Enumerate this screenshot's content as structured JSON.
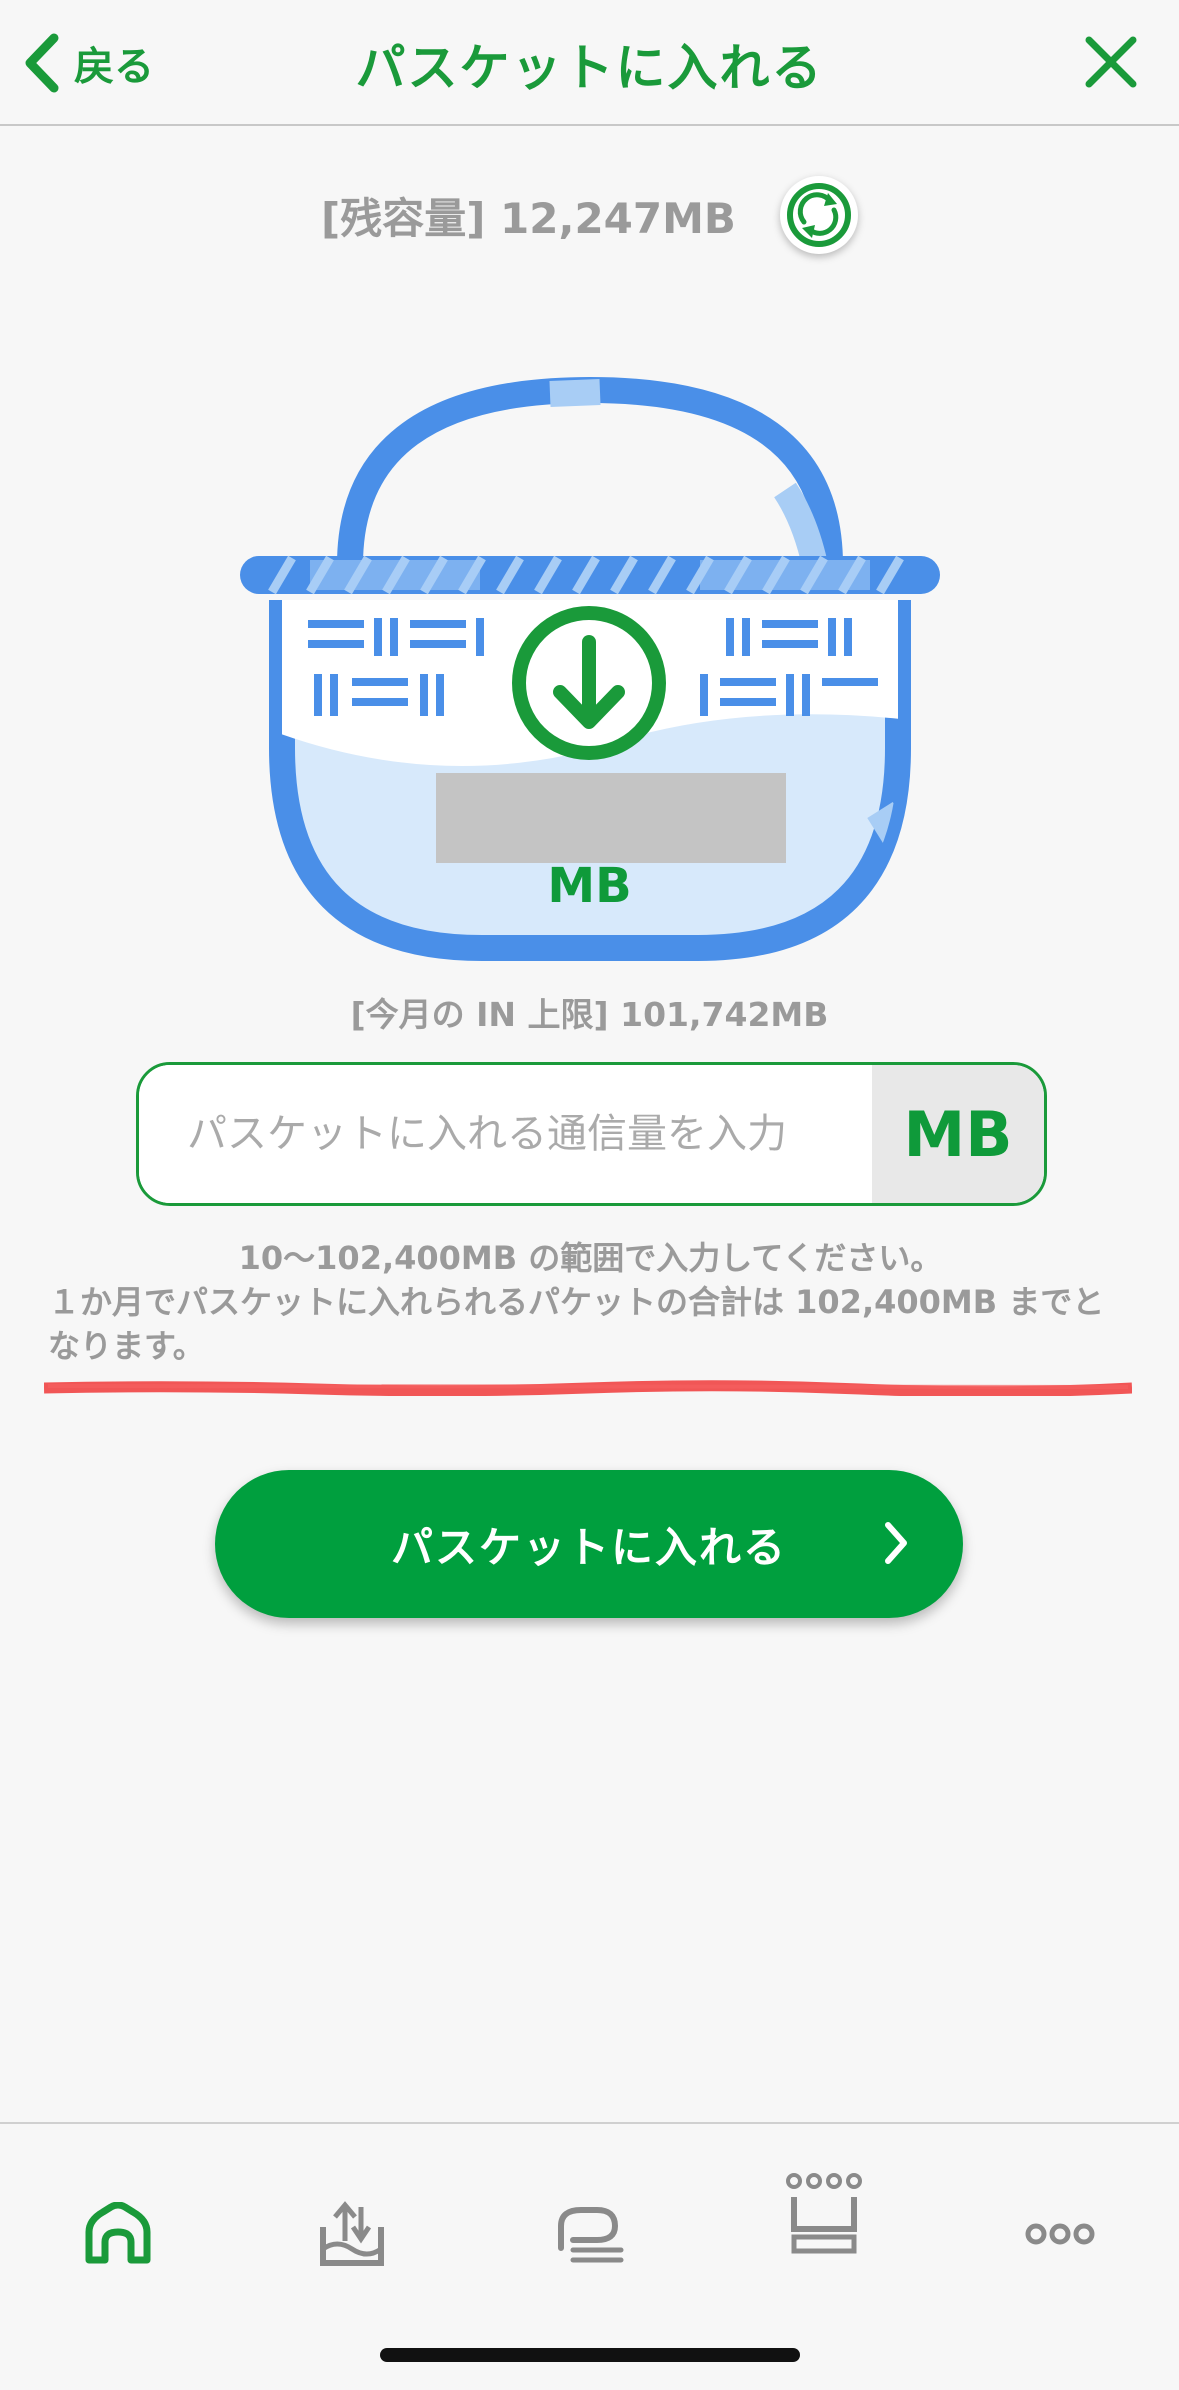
{
  "header": {
    "back_label": "戻る",
    "title": "パスケットに入れる"
  },
  "remaining": {
    "text": "[残容量] 12,247MB"
  },
  "basket": {
    "amount_unit": "MB"
  },
  "limit": {
    "text": "[今月の IN 上限] 101,742MB"
  },
  "input": {
    "placeholder": "パスケットに入れる通信量を入力",
    "value": "",
    "unit": "MB"
  },
  "help": {
    "line1": "10～102,400MB の範囲で入力してください。",
    "line2": "１か月でパスケットに入れられるパケットの合計は 102,400MB までとなります。"
  },
  "submit": {
    "label": "パスケットに入れる"
  },
  "tabs": [
    {
      "icon": "home-icon",
      "active": true
    },
    {
      "icon": "upload-tray-icon",
      "active": false
    },
    {
      "icon": "chat-icon",
      "active": false
    },
    {
      "icon": "crown-icon",
      "active": false
    },
    {
      "icon": "more-icon",
      "active": false
    }
  ],
  "colors": {
    "accent": "#1a9a3a",
    "button": "#009f3e",
    "basket_blue": "#4a8fe8",
    "basket_light": "#a8cdf5",
    "text_gray": "#9a9a9a",
    "alert_red": "#f03a3a"
  }
}
